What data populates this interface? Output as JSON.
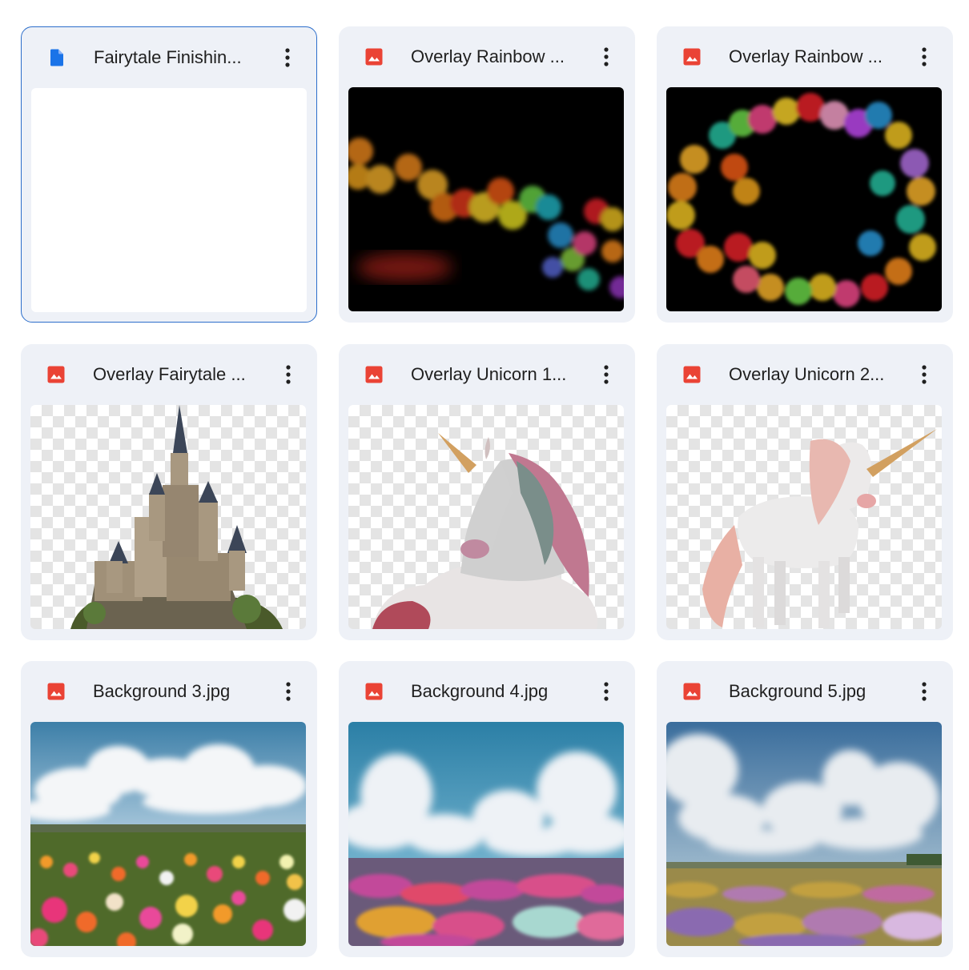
{
  "files": [
    {
      "name": "Fairytale Finishin...",
      "type": "doc",
      "icon": "doc-file-icon",
      "selected": true,
      "thumbnail": "blank-document-preview"
    },
    {
      "name": "Overlay Rainbow ...",
      "type": "image",
      "icon": "image-file-icon",
      "thumbnail": "rainbow-bokeh-wave"
    },
    {
      "name": "Overlay Rainbow ...",
      "type": "image",
      "icon": "image-file-icon",
      "thumbnail": "rainbow-bokeh-ring"
    },
    {
      "name": "Overlay Fairytale ...",
      "type": "image",
      "icon": "image-file-icon",
      "thumbnail": "castle-on-transparent"
    },
    {
      "name": "Overlay Unicorn 1...",
      "type": "image",
      "icon": "image-file-icon",
      "thumbnail": "lying-unicorn-on-transparent"
    },
    {
      "name": "Overlay Unicorn 2...",
      "type": "image",
      "icon": "image-file-icon",
      "thumbnail": "standing-unicorn-on-transparent"
    },
    {
      "name": "Background 3.jpg",
      "type": "image",
      "icon": "image-file-icon",
      "thumbnail": "flower-field-clouds"
    },
    {
      "name": "Background 4.jpg",
      "type": "image",
      "icon": "image-file-icon",
      "thumbnail": "flower-meadow-big-clouds"
    },
    {
      "name": "Background 5.jpg",
      "type": "image",
      "icon": "image-file-icon",
      "thumbnail": "meadow-cloudy-sky"
    }
  ],
  "colors": {
    "doc_icon": "#1a73e8",
    "image_icon": "#ea4335",
    "card_bg": "#eef1f7",
    "selected_border": "#2c6ecb",
    "text": "#1f1f1f"
  },
  "more_actions_icon": "more-vert-icon"
}
